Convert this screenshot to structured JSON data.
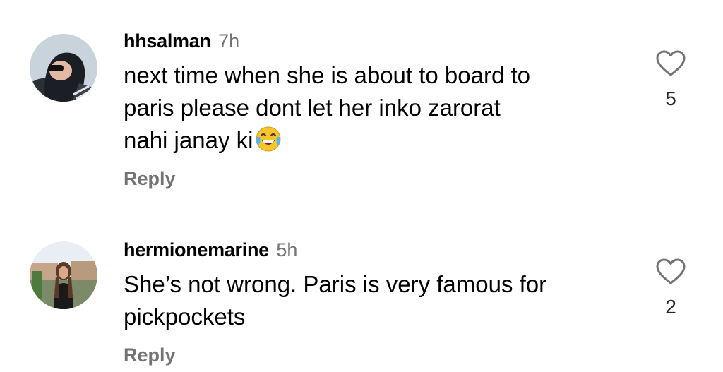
{
  "comments": [
    {
      "username": "hhsalman",
      "time": "7h",
      "text_lines": "next time when she is about to board to\nparis please dont let her inko zarorat\nnahi janay ki",
      "emoji": "face-with-tears-of-joy",
      "reply_label": "Reply",
      "like_count": "5"
    },
    {
      "username": "hermionemarine",
      "time": "5h",
      "text_lines": "She’s not wrong. Paris is very famous for\npickpockets",
      "reply_label": "Reply",
      "like_count": "2"
    }
  ],
  "icons": {
    "like": "heart-outline-icon"
  },
  "colors": {
    "secondary_text": "#737373",
    "avatar_1_bg": "#c9d3db",
    "avatar_2_sky": "#e8eef4"
  }
}
